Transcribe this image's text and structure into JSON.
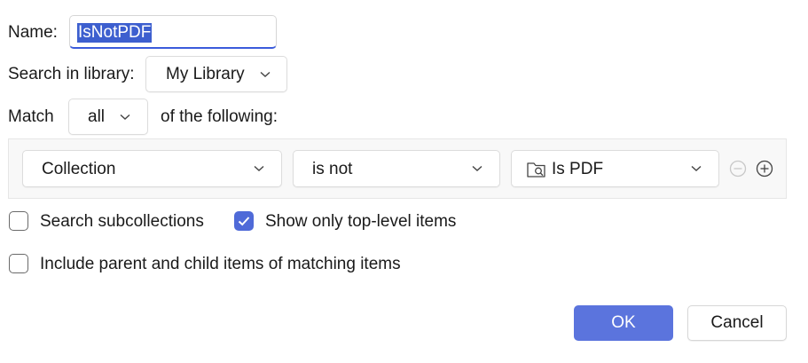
{
  "name": {
    "label": "Name:",
    "value": "IsNotPDF"
  },
  "library": {
    "label": "Search in library:",
    "selected": "My Library"
  },
  "match": {
    "label": "Match",
    "selected": "all",
    "suffix": "of the following:"
  },
  "condition": {
    "field": "Collection",
    "operator": "is not",
    "value": "Is PDF",
    "value_icon": "saved-search-folder-icon",
    "remove_icon": "minus-circle-icon",
    "add_icon": "plus-circle-icon"
  },
  "options": {
    "search_subcollections": {
      "label": "Search subcollections",
      "checked": false
    },
    "top_level_only": {
      "label": "Show only top-level items",
      "checked": true
    },
    "include_parent_child": {
      "label": "Include parent and child items of matching items",
      "checked": false
    }
  },
  "buttons": {
    "ok": "OK",
    "cancel": "Cancel"
  },
  "colors": {
    "accent": "#4f6ad8",
    "ok_button": "#5b74dd",
    "selection": "#3d5fcf"
  }
}
